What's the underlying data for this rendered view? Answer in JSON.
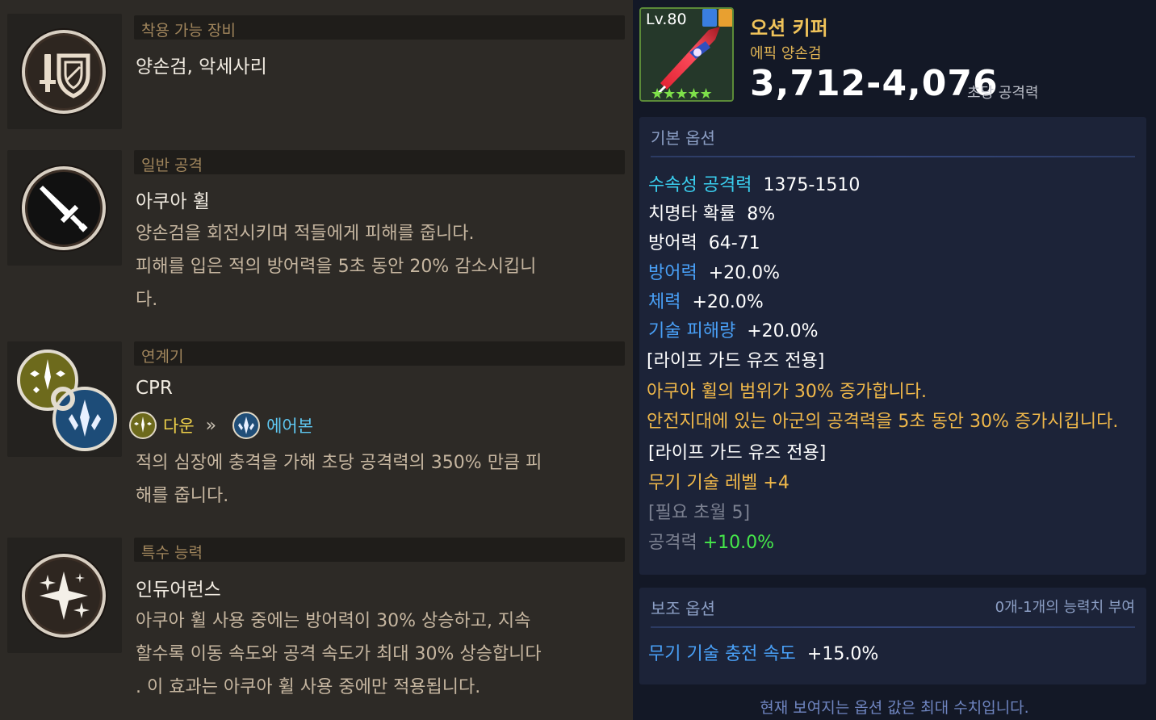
{
  "left": {
    "equip": {
      "category": "착용 가능 장비",
      "title": "양손검, 악세사리",
      "icon": "sword-shield-icon"
    },
    "normal": {
      "category": "일반 공격",
      "title": "아쿠아 휠",
      "desc_lines": [
        "양손검을 회전시키며 적들에게 피해를 줍니다.",
        "피해를 입은 적의 방어력을 5초 동안 20% 감소시킵니",
        "다."
      ],
      "icon": "sword-icon"
    },
    "combo": {
      "category": "연계기",
      "title": "CPR",
      "from_label": "다운",
      "arrow": "»",
      "to_label": "에어본",
      "desc_lines": [
        "적의 심장에 충격을 가해 초당 공격력의 350% 만큼 피",
        "해를 줍니다."
      ],
      "icon": "chain-link-icon"
    },
    "special": {
      "category": "특수 능력",
      "title": "인듀어런스",
      "desc_lines": [
        "아쿠아 휠 사용 중에는 방어력이 30% 상승하고, 지속",
        "할수록 이동 속도와 공격 속도가 최대 30% 상승합니다",
        ". 이 효과는 아쿠아 휠 사용 중에만 적용됩니다."
      ],
      "icon": "sparkle-icon"
    }
  },
  "item": {
    "level": "Lv.80",
    "name": "오션 키퍼",
    "type": "에픽 양손검",
    "dps": "3,712-4,076",
    "dps_label": "초당 공격력",
    "stars": "★★★★★",
    "star_count": 5
  },
  "basic_options": {
    "header": "기본 옵션",
    "rows": [
      {
        "label": "수속성 공격력",
        "value": "1375-1510"
      },
      {
        "label": "치명타 확률",
        "value": "8%"
      },
      {
        "label": "방어력",
        "value": "64-71"
      },
      {
        "label": "방어력",
        "value": "+20.0%"
      },
      {
        "label": "체력",
        "value": "+20.0%"
      },
      {
        "label": "기술 피해량",
        "value": "+20.0%"
      }
    ],
    "set1_title": "[라이프 가드 유즈 전용]",
    "set1_lines": [
      "아쿠아 휠의 범위가 30% 증가합니다.",
      "안전지대에 있는 아군의 공격력을 5초 동안 30% 증가시킵니다."
    ],
    "set2_title": "[라이프 가드 유즈 전용]",
    "set2_line": "무기 기술 레벨 +4",
    "require": "[필요 초월 5]",
    "attack_label": "공격력",
    "attack_value": "+10.0%"
  },
  "sub_options": {
    "header": "보조 옵션",
    "header_right": "0개-1개의 능력치 부여",
    "row_label": "무기 기술 충전 속도",
    "row_value": "+15.0%"
  },
  "footer": "현재 보여지는 옵션 값은 최대 수치입니다.",
  "colors": {
    "left_bg": "#2d2a26",
    "right_bg": "#131826",
    "category_text": "#a0855c",
    "item_name": "#f0c35a",
    "cyan": "#3ad0f0",
    "blue": "#49a0f7",
    "orange": "#f0b84a",
    "green": "#45e84a"
  }
}
